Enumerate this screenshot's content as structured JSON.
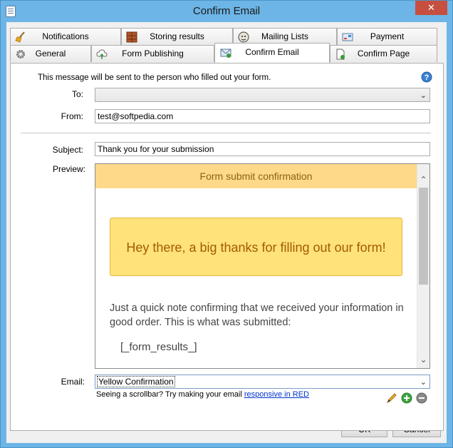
{
  "window": {
    "title": "Confirm Email"
  },
  "tabs": {
    "row1": [
      {
        "label": "Notifications",
        "icon": "broom-icon"
      },
      {
        "label": "Storing results",
        "icon": "cabinet-icon"
      },
      {
        "label": "Mailing Lists",
        "icon": "mailchimp-icon"
      },
      {
        "label": "Payment",
        "icon": "payment-icon"
      }
    ],
    "row2": [
      {
        "label": "General",
        "icon": "gear-icon"
      },
      {
        "label": "Form Publishing",
        "icon": "cloud-upload-icon"
      },
      {
        "label": "Confirm Email",
        "icon": "email-icon",
        "selected": true
      },
      {
        "label": "Confirm Page",
        "icon": "page-icon"
      }
    ]
  },
  "form": {
    "intro": "This message will be sent to the person who filled out your form.",
    "to_label": "To:",
    "to_value": "",
    "from_label": "From:",
    "from_value": "test@softpedia.com",
    "subject_label": "Subject:",
    "subject_value": "Thank you for your submission",
    "preview_label": "Preview:",
    "email_label": "Email:",
    "email_value": "Yellow Confirmation"
  },
  "preview": {
    "header": "Form submit confirmation",
    "thanks": "Hey there, a big thanks for filling out our form!",
    "note": "Just a quick note confirming that we received your information in good order. This is what was submitted:",
    "results": "[_form_results_]"
  },
  "hint": {
    "text": "Seeing a scrollbar? Try making your email ",
    "link": "responsive in RED"
  },
  "buttons": {
    "ok": "OK",
    "cancel": "Cancel"
  },
  "colors": {
    "title_bar": "#6cb5e6",
    "close_button": "#c74f3f",
    "preview_header": "#ffd98a",
    "thanks_box": "#ffe27a",
    "link": "#0033cc"
  }
}
